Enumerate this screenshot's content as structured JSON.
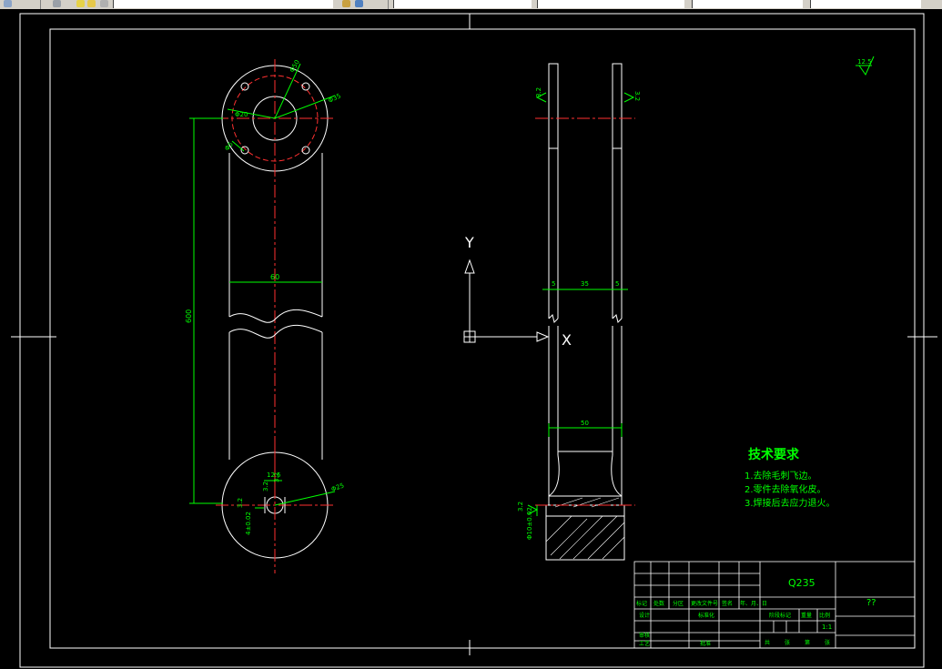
{
  "toolbar": {
    "field1": "",
    "field2": "",
    "field3": "",
    "field4": "",
    "field5": ""
  },
  "front_view": {
    "dim_length": "600",
    "dim_width": "60",
    "dim_flange_dia": "Φ50",
    "dim_bolt_circle": "Φ35",
    "dim_hole_dia": "Φ20",
    "dim_small_hole": "Φ5",
    "dim_bottom_dia": "Φ25",
    "dim_hole_depth": "12.5",
    "dim_tol": "4±0.02",
    "roughness_front1": "3.2",
    "roughness_front2": "3.2",
    "roughness_front3": "3.2"
  },
  "side_view": {
    "dim_left": "5",
    "dim_mid": "35",
    "dim_right": "5",
    "dim_bottom_width": "50",
    "dim_bottom_dia": "Φ10±0.02",
    "roughness_left": "3.2",
    "roughness_right": "3.2",
    "roughness_bottom": "3.2"
  },
  "ucs": {
    "y_label": "Y",
    "x_label": "X"
  },
  "roughness_general": "12.5",
  "tech_requirements": {
    "title": "技术要求",
    "items": [
      "1.去除毛刺飞边。",
      "2.零件去除氧化皮。",
      "3.焊接后去应力退火。"
    ]
  },
  "title_block": {
    "material": "Q235",
    "part_name": "??",
    "scale": "1:1",
    "row_labels": [
      "标记",
      "处数",
      "分区",
      "更改文件号",
      "签名",
      "年、月、日"
    ],
    "designer": "设计",
    "standard": "标准化",
    "checker": "审核",
    "process": "工艺",
    "approve": "批准",
    "stage_mark": "阶段标记",
    "weight": "重量",
    "ratio": "比例",
    "sheet_total": "共",
    "sheet_unit": "张",
    "sheet_no": "第",
    "sheet_unit2": "张"
  },
  "colors": {
    "background": "#000000",
    "outline": "#ffffff",
    "center_line": "#ff0000",
    "dimension": "#00ff00",
    "hatch": "#ffffff"
  }
}
